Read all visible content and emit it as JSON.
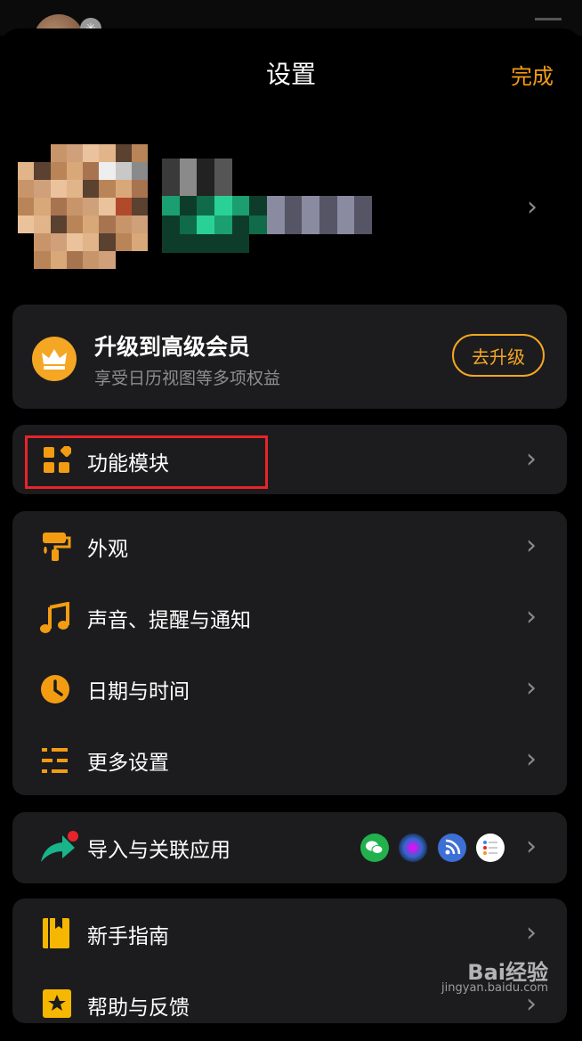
{
  "header": {
    "title": "设置",
    "done_label": "完成"
  },
  "vip": {
    "title": "升级到高级会员",
    "subtitle": "享受日历视图等多项权益",
    "button_label": "去升级"
  },
  "modules": {
    "label": "功能模块"
  },
  "settings_group": {
    "items": [
      {
        "label": "外观",
        "icon": "paint-roller-icon"
      },
      {
        "label": "声音、提醒与通知",
        "icon": "music-note-icon"
      },
      {
        "label": "日期与时间",
        "icon": "clock-icon"
      },
      {
        "label": "更多设置",
        "icon": "list-settings-icon"
      }
    ]
  },
  "import": {
    "label": "导入与关联应用",
    "icon": "share-arrow-icon",
    "apps": [
      "wechat-icon",
      "siri-icon",
      "rss-icon",
      "reminders-icon"
    ]
  },
  "help_group": {
    "items": [
      {
        "label": "新手指南",
        "icon": "book-icon"
      },
      {
        "label": "帮助与反馈",
        "icon": "star-icon"
      }
    ]
  },
  "watermark": {
    "brand": "Bai经验",
    "url": "jingyan.baidu.com"
  },
  "colors": {
    "accent": "#f39c12",
    "card": "#1c1c1e",
    "highlight": "#e8242b"
  }
}
